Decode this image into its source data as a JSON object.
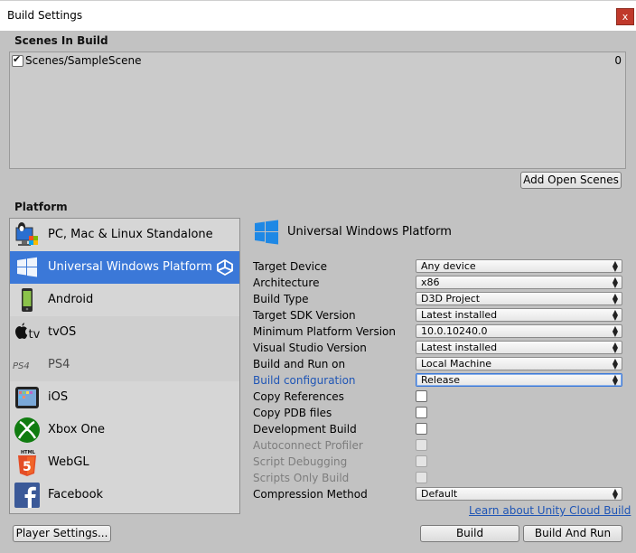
{
  "window": {
    "title": "Build Settings",
    "close_label": "x"
  },
  "scenes": {
    "title": "Scenes In Build",
    "items": [
      {
        "name": "Scenes/SampleScene",
        "index": "0",
        "checked": true
      }
    ],
    "add_button": "Add Open Scenes"
  },
  "platform": {
    "title": "Platform",
    "items": [
      {
        "label": "PC, Mac & Linux Standalone",
        "icon": "standalone-icon"
      },
      {
        "label": "Universal Windows Platform",
        "icon": "windows-icon",
        "selected": true
      },
      {
        "label": "Android",
        "icon": "android-icon"
      },
      {
        "label": "tvOS",
        "icon": "tvos-icon"
      },
      {
        "label": "PS4",
        "icon": "ps4-icon"
      },
      {
        "label": "iOS",
        "icon": "ios-icon"
      },
      {
        "label": "Xbox One",
        "icon": "xbox-icon"
      },
      {
        "label": "WebGL",
        "icon": "html5-icon"
      },
      {
        "label": "Facebook",
        "icon": "facebook-icon"
      }
    ],
    "tvos_mark": "tv",
    "ps4_mark": "PS4",
    "html_mark": "HTML"
  },
  "settings": {
    "title": "Universal Windows Platform",
    "rows": [
      {
        "label": "Target Device",
        "value": "Any device"
      },
      {
        "label": "Architecture",
        "value": "x86"
      },
      {
        "label": "Build Type",
        "value": "D3D Project"
      },
      {
        "label": "Target SDK Version",
        "value": "Latest installed"
      },
      {
        "label": "Minimum Platform Version",
        "value": "10.0.10240.0"
      },
      {
        "label": "Visual Studio Version",
        "value": "Latest installed"
      },
      {
        "label": "Build and Run on",
        "value": "Local Machine"
      },
      {
        "label": "Build configuration",
        "value": "Release"
      },
      {
        "label": "Copy References",
        "checked": false
      },
      {
        "label": "Copy PDB files",
        "checked": false
      },
      {
        "label": "Development Build",
        "checked": false
      },
      {
        "label": "Autoconnect Profiler",
        "checked": false,
        "disabled": true
      },
      {
        "label": "Script Debugging",
        "checked": false,
        "disabled": true
      },
      {
        "label": "Scripts Only Build",
        "checked": false,
        "disabled": true
      },
      {
        "label": "Compression Method",
        "value": "Default"
      }
    ],
    "cloud_link": "Learn about Unity Cloud Build"
  },
  "footer": {
    "player_settings": "Player Settings...",
    "build": "Build",
    "build_and_run": "Build And Run"
  },
  "colors": {
    "selection": "#3b78d8",
    "link": "#1f55b5",
    "close": "#c0392b"
  }
}
